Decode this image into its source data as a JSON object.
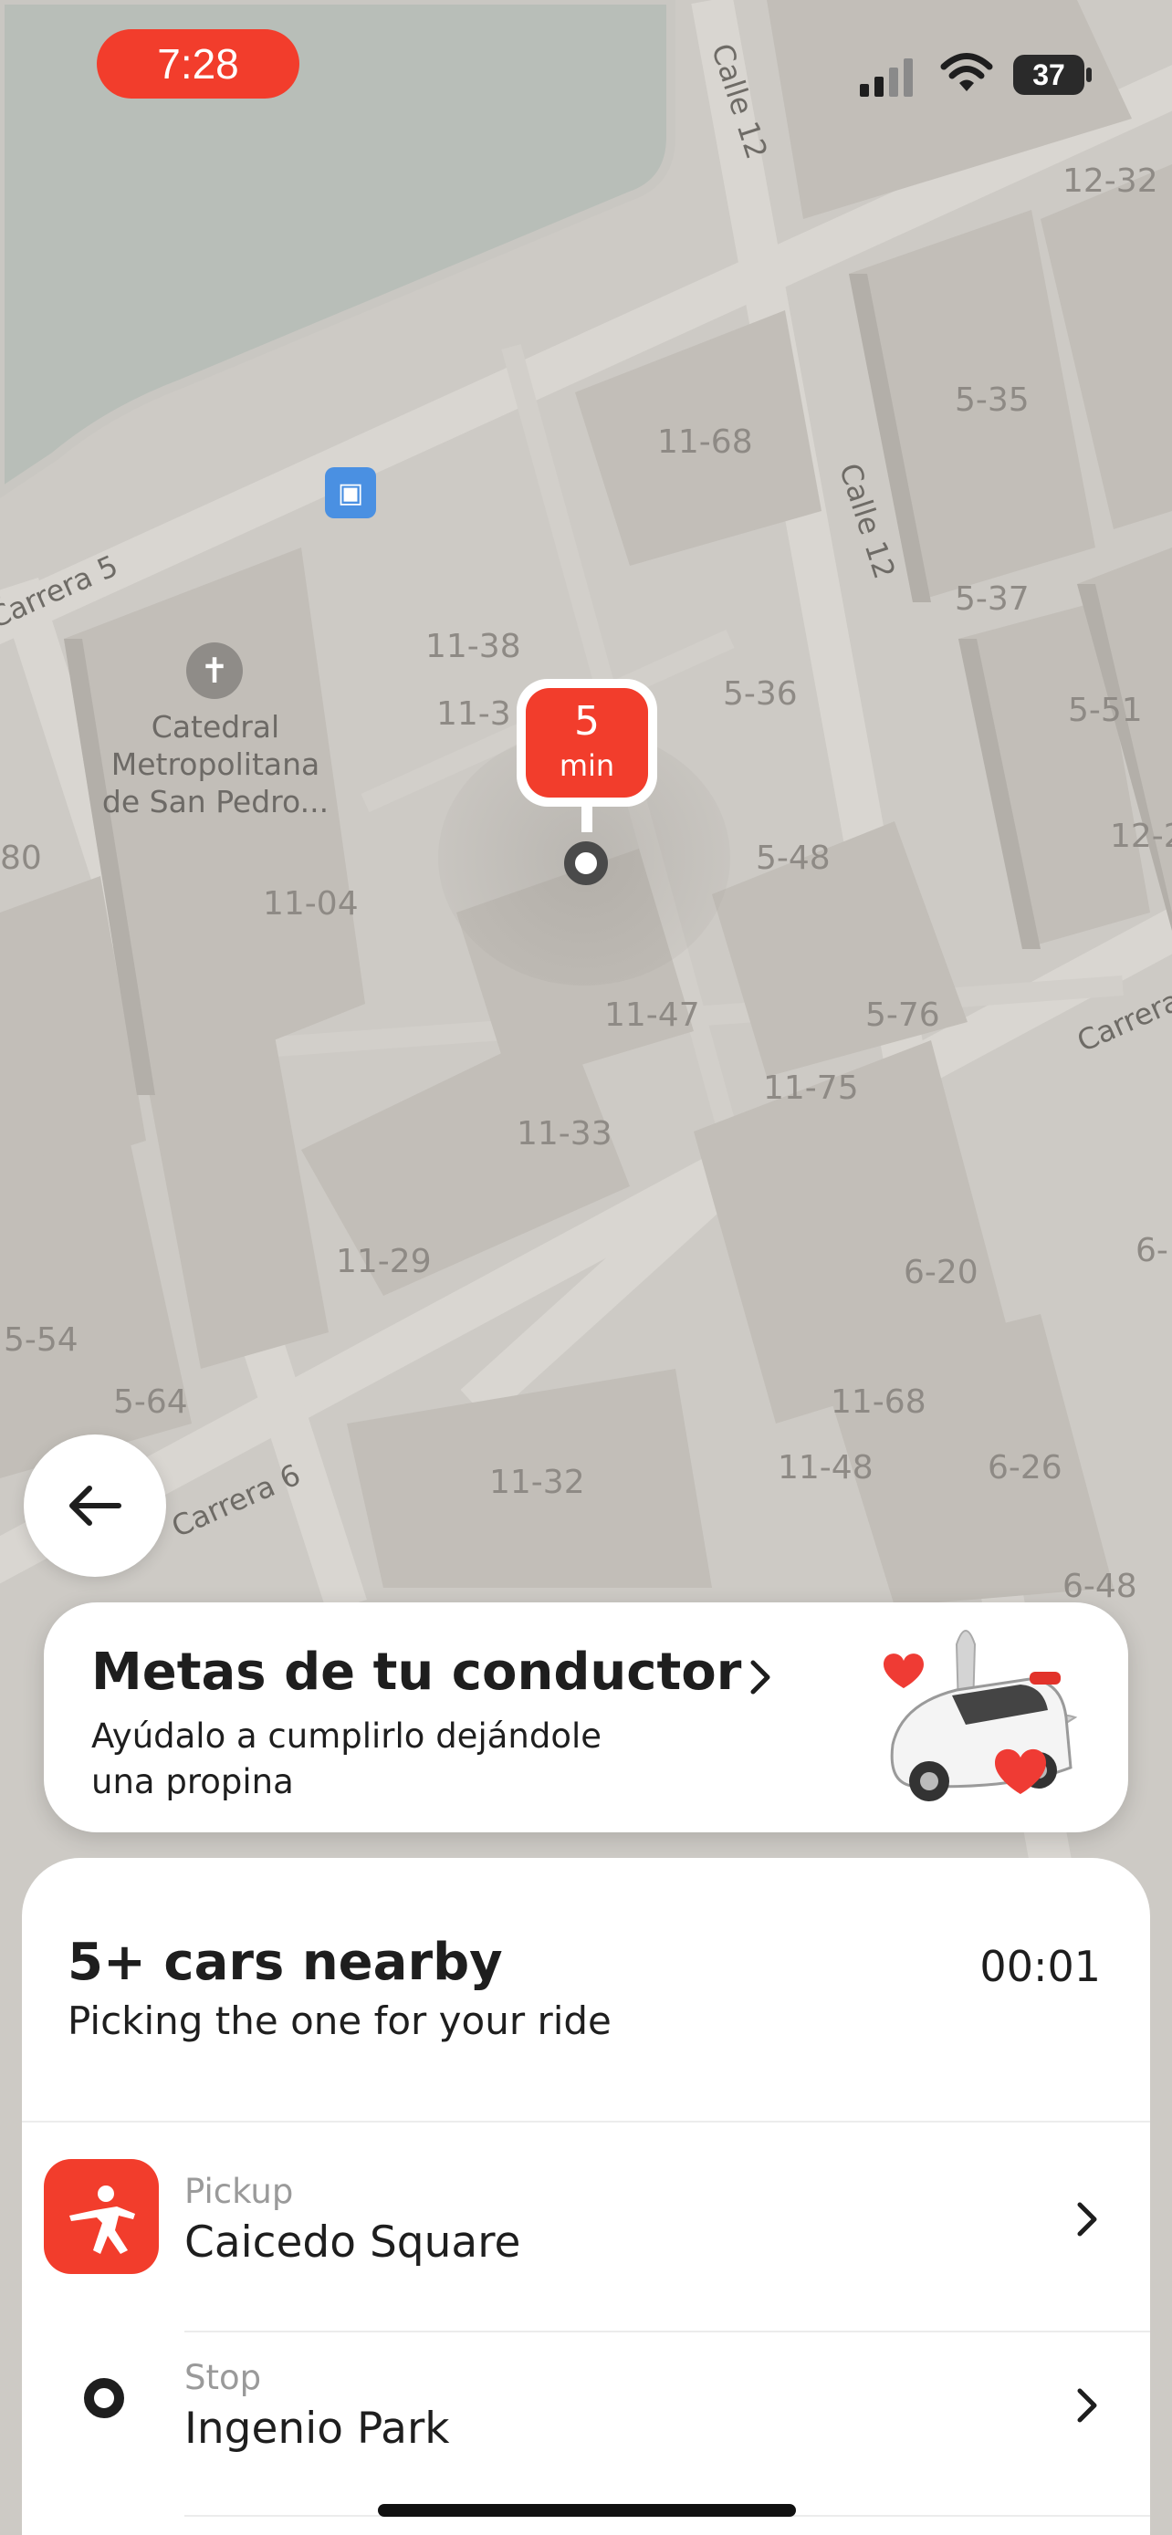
{
  "status_bar": {
    "time": "7:28",
    "battery": "37",
    "time_pill_color": "#f23d2c"
  },
  "map": {
    "streets": [
      "Calle 12",
      "Carrera 5",
      "Calle 12",
      "Carrera 6",
      "Carrera"
    ],
    "poi": {
      "name_line1": "Catedral",
      "name_line2": "Metropolitana",
      "name_line3": "de San Pedro...",
      "icon": "cross-icon"
    },
    "transit_icon": "bus-icon",
    "building_numbers": [
      "12-32",
      "11-68",
      "5-35",
      "5-37",
      "11-38",
      "11-3",
      "5-36",
      "5-51",
      "12-2",
      "80",
      "11-04",
      "5-48",
      "11-47",
      "5-76",
      "11-75",
      "11-33",
      "6-20",
      "11-29",
      "5-54",
      "5-64",
      "11-68",
      "11-48",
      "6-26",
      "11-32",
      "6-48",
      "6-"
    ],
    "eta_pin": {
      "value": "5",
      "unit": "min"
    }
  },
  "back_button": {
    "icon": "arrow-left-icon"
  },
  "promo": {
    "title": "Metas de tu conductor",
    "subtitle_line1": "Ayúdalo a cumplirlo dejándole",
    "subtitle_line2": "una propina",
    "chevron_icon": "chevron-right-icon",
    "illustration": "car-with-hearts-illustration"
  },
  "sheet": {
    "title": "5+ cars nearby",
    "timer": "00:01",
    "subtitle": "Picking the one for your ride",
    "pickup": {
      "label": "Pickup",
      "value": "Caicedo Square",
      "icon": "person-waving-icon"
    },
    "stop": {
      "label": "Stop",
      "value": "Ingenio Park",
      "icon": "stop-circle-icon"
    }
  }
}
